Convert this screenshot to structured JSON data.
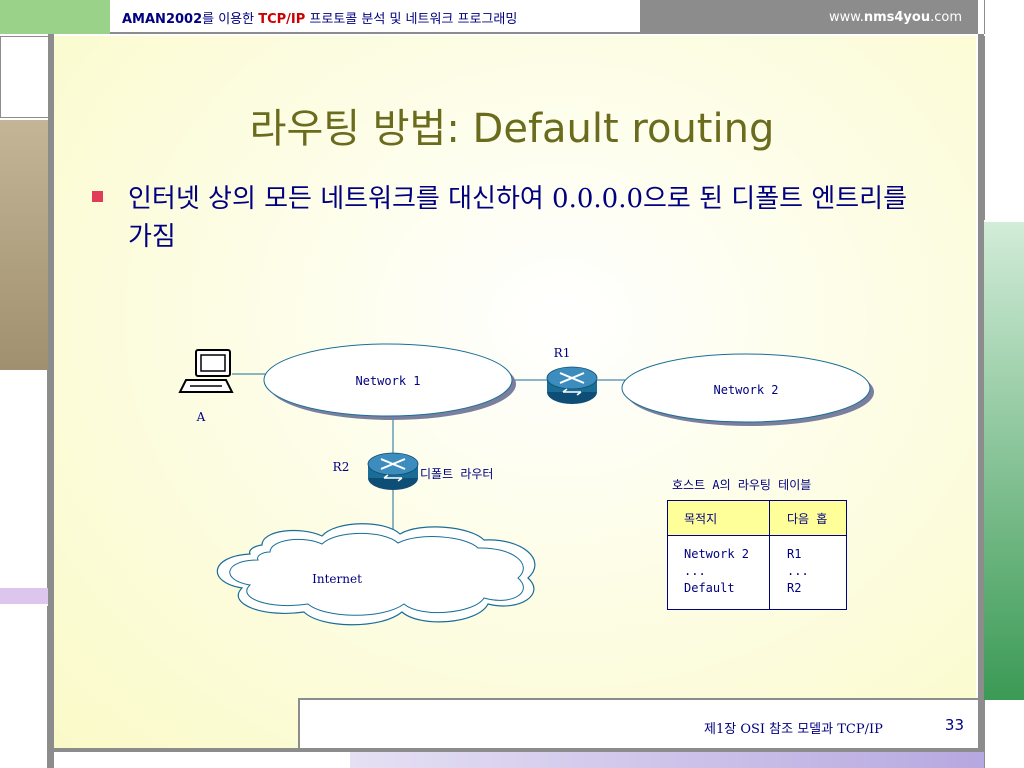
{
  "header": {
    "brand": "AMAN2002",
    "text_a": "를 이용한 ",
    "protocol": "TCP/IP",
    "text_b": " 프로토콜 분석 및 네트워크 프로그래밍",
    "site_prefix": "www.",
    "site_name": "nms4you",
    "site_suffix": ".com"
  },
  "title": "라우팅 방법: Default routing",
  "bullet": {
    "text_a": "인터넷 상의 모든 네트워크를 대신하여 ",
    "ip": "0.0.0.0",
    "text_b": "으로 된 디폴트 엔트리를 가짐"
  },
  "diagram": {
    "host_label": "A",
    "network1": "Network 1",
    "network2": "Network 2",
    "router1": "R1",
    "router2": "R2",
    "router2_desc": "디폴트 라우터",
    "internet": "Internet"
  },
  "routing_table": {
    "caption": "호스트 A의 라우팅 테이블",
    "headers": [
      "목적지",
      "다음 홉"
    ],
    "col1": "Network 2\n...\nDefault",
    "col2": "R1\n...\nR2"
  },
  "footer": {
    "chapter": "제1장  OSI 참조 모델과 TCP/IP",
    "page": "33"
  },
  "colors": {
    "title": "#6b6b1e",
    "text": "#000080",
    "bullet": "#e03c5a",
    "header_red": "#cc0000",
    "router": "#1a6e96"
  }
}
